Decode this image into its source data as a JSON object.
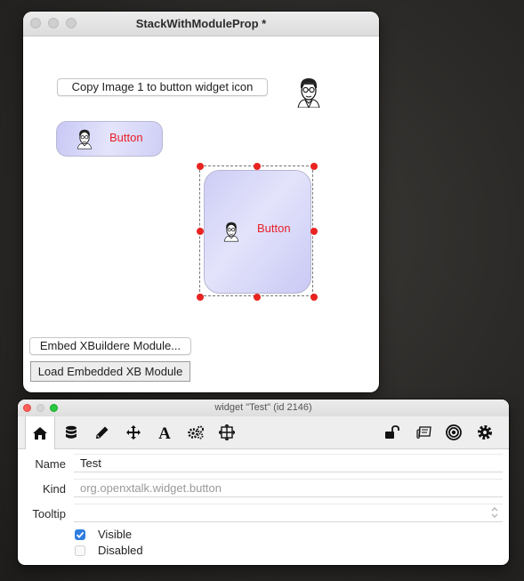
{
  "stack_window": {
    "title": "StackWithModuleProp *",
    "copy_button_label": "Copy Image 1 to button widget icon",
    "small_widget_label": "Button",
    "big_widget_label": "Button",
    "embed_button_label": "Embed XBuildere Module...",
    "load_button_label": "Load Embedded XB Module"
  },
  "inspector": {
    "title": "widget \"Test\" (id 2146)",
    "tabs": [
      "home-icon",
      "database-icon",
      "pencil-icon",
      "move-icon",
      "text-icon",
      "gears-icon",
      "geometry-icon"
    ],
    "right_tools": [
      "lock-icon",
      "message-icon",
      "target-icon",
      "gear-icon"
    ],
    "fields": {
      "name_label": "Name",
      "name_value": "Test",
      "kind_label": "Kind",
      "kind_value": "org.openxtalk.widget.button",
      "tooltip_label": "Tooltip",
      "tooltip_value": ""
    },
    "checkboxes": {
      "visible_label": "Visible",
      "visible_checked": true,
      "disabled_label": "Disabled",
      "disabled_checked": false
    },
    "accent_color": "#2f7de1"
  },
  "colors": {
    "widget_text": "#e8202a",
    "selection_handle": "#e82320",
    "traffic_red": "#fe5f57",
    "traffic_yellow": "#febc2e",
    "traffic_green": "#28c840"
  }
}
